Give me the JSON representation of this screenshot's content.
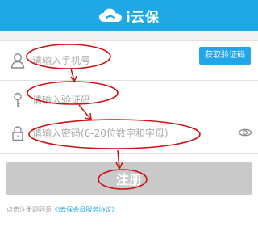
{
  "header": {
    "app_name": "i云保",
    "bg_color": "#1ea8e6"
  },
  "form": {
    "phone": {
      "placeholder": "请输入手机号",
      "icon": "user-icon"
    },
    "code": {
      "placeholder": "请输入验证码",
      "icon": "key-icon"
    },
    "password": {
      "placeholder": "请输入密码(6-20位数字和字母)",
      "icon": "lock-icon",
      "toggle_icon": "eye-icon"
    },
    "get_code_label": "获取验证码",
    "accent_color": "#21a6ea"
  },
  "register": {
    "label": "注册",
    "bg_color": "#c9c9c9"
  },
  "agreement": {
    "prefix": "点击注册即同意",
    "link": "《i云保会员服务协议》"
  },
  "annotation_color": "#cc1111"
}
